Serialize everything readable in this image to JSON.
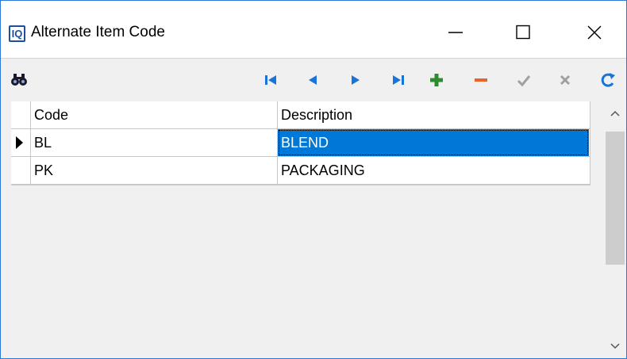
{
  "window": {
    "logo_text": "IQ",
    "title": "Alternate Item Code"
  },
  "toolbar": {
    "icons": [
      "binoculars-search-icon",
      "first-record-icon",
      "prior-record-icon",
      "next-record-icon",
      "last-record-icon",
      "insert-record-icon",
      "delete-record-icon",
      "post-edit-icon",
      "cancel-edit-icon",
      "refresh-icon"
    ]
  },
  "grid": {
    "columns": [
      "Code",
      "Description"
    ],
    "rows": [
      {
        "code": "BL",
        "description": "BLEND",
        "current": true
      },
      {
        "code": "PK",
        "description": "PACKAGING",
        "current": false
      }
    ]
  },
  "colors": {
    "nav_blue": "#1a73d9",
    "add_green": "#2e8b2e",
    "delete_orange": "#e8622a",
    "disabled_gray": "#a0a0a0",
    "selection": "#0078d7"
  }
}
